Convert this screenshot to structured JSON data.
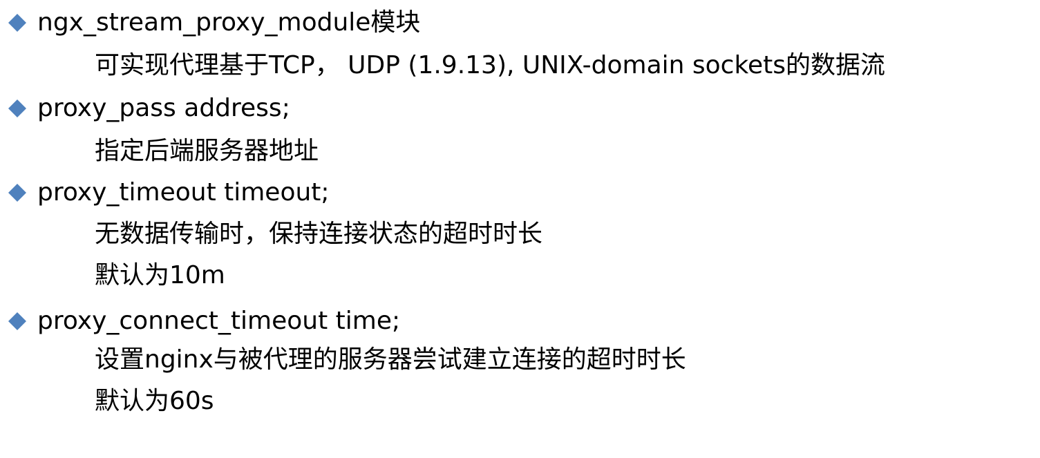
{
  "colors": {
    "bullet": "#4F81BD",
    "text": "#000000",
    "background": "#FFFFFF"
  },
  "bullets": [
    {
      "icon": "diamond-bullet-icon",
      "text": "ngx_stream_proxy_module模块",
      "lines": [
        "可实现代理基于TCP， UDP (1.9.13), UNIX-domain sockets的数据流"
      ]
    },
    {
      "icon": "diamond-bullet-icon",
      "text": "proxy_pass address;",
      "lines": [
        "指定后端服务器地址"
      ]
    },
    {
      "icon": "diamond-bullet-icon",
      "text": "proxy_timeout timeout;",
      "lines": [
        "无数据传输时，保持连接状态的超时时长",
        "默认为10m"
      ]
    },
    {
      "icon": "diamond-bullet-icon",
      "text": "proxy_connect_timeout time;",
      "lines": [
        "设置nginx与被代理的服务器尝试建立连接的超时时长",
        "默认为60s"
      ]
    }
  ]
}
